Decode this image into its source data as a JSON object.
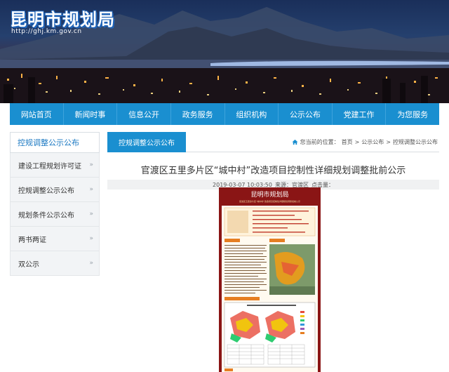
{
  "header": {
    "site_title": "昆明市规划局",
    "site_url": "http://ghj.km.gov.cn"
  },
  "nav": {
    "items": [
      {
        "label": "网站首页"
      },
      {
        "label": "新闻时事"
      },
      {
        "label": "信息公开"
      },
      {
        "label": "政务服务"
      },
      {
        "label": "组织机构"
      },
      {
        "label": "公示公布"
      },
      {
        "label": "党建工作"
      },
      {
        "label": "为您服务"
      }
    ]
  },
  "sidebar": {
    "title": "控规调整公示公布",
    "items": [
      {
        "label": "建设工程规划许可证"
      },
      {
        "label": "控规调整公示公布"
      },
      {
        "label": "规划条件公示公布"
      },
      {
        "label": "两书两证"
      },
      {
        "label": "双公示"
      }
    ],
    "chevron": "»"
  },
  "main": {
    "tab_label": "控规调整公示公布",
    "breadcrumb": {
      "prefix": "您当前的位置：",
      "items": [
        "首页",
        "公示公布",
        "控规调整公示公布"
      ],
      "separator": ">"
    },
    "article_title": "官渡区五里多片区“城中村”改造项目控制性详细规划调整批前公示",
    "meta": {
      "date": "2019-03-07 10:03:50",
      "source": "来源：官渡区",
      "clicks": "点击量："
    }
  },
  "poster": {
    "title": "昆明市规划局",
    "subtitle": "官渡区五里多片区“城中村”改造项目控制性详细规划调整批前公示"
  },
  "colors": {
    "brand_blue": "#1a8fd0",
    "sidebar_title": "#1a78c2",
    "poster_red": "#8a1515"
  },
  "icons": {
    "breadcrumb": "home-icon",
    "sidebar": "chevron-right-icon"
  }
}
